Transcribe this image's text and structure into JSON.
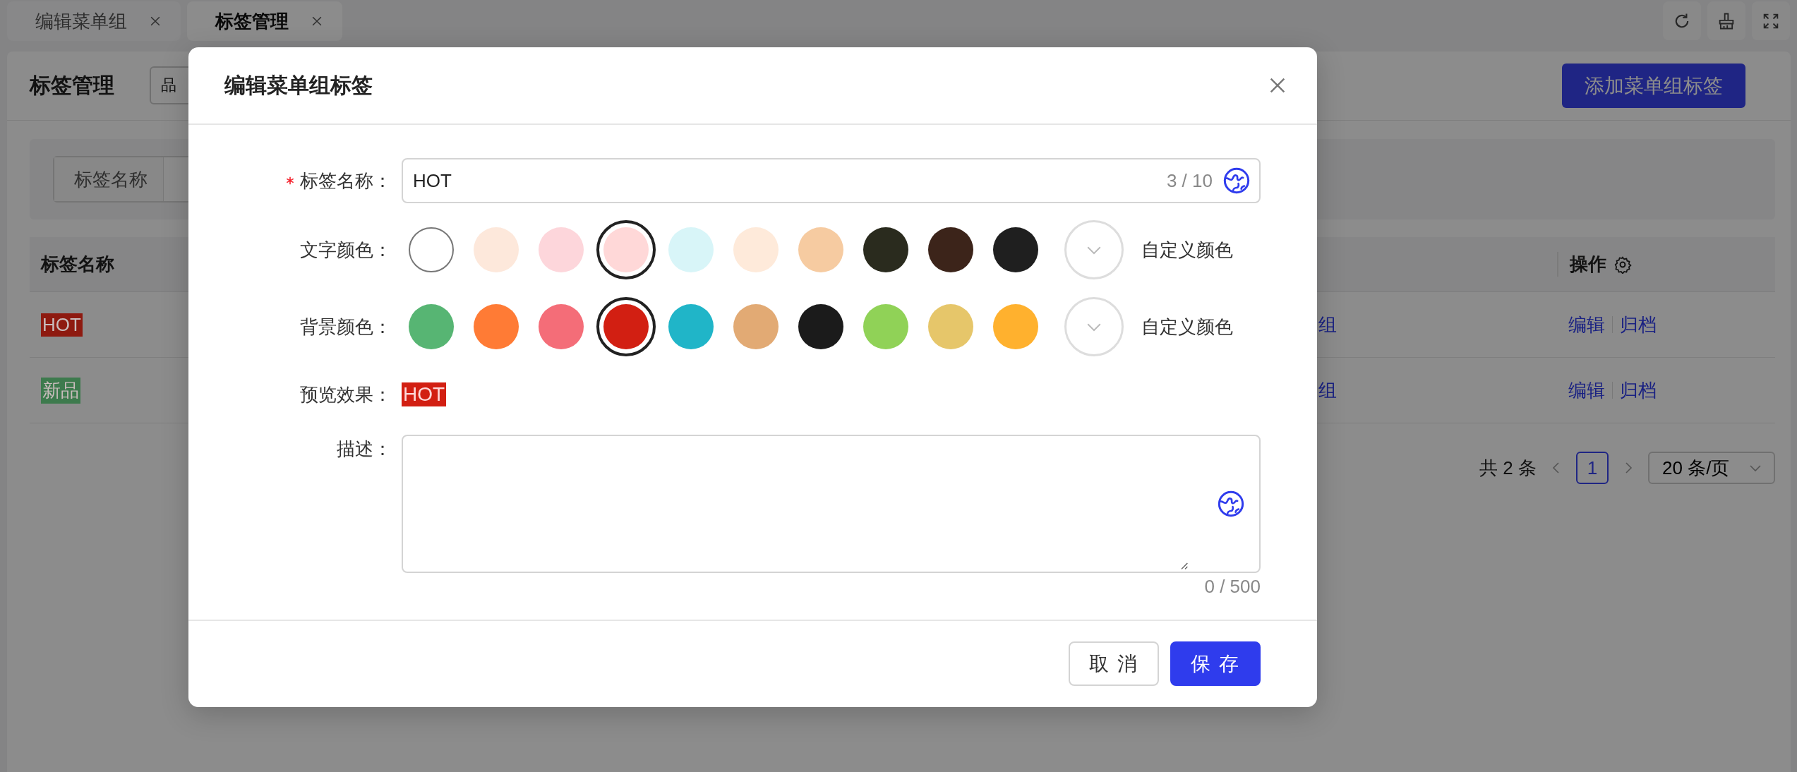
{
  "tabs": [
    {
      "label": "编辑菜单组",
      "selected": false
    },
    {
      "label": "标签管理",
      "selected": true
    }
  ],
  "page": {
    "title": "标签管理",
    "select_value": "品",
    "add_button": "添加菜单组标签"
  },
  "filter": {
    "field_label": "标签名称"
  },
  "table": {
    "columns": [
      {
        "label": "标签名称"
      },
      {
        "label": "操作"
      }
    ],
    "rows": [
      {
        "tag": "HOT",
        "color": "#8e1a10",
        "column_2": "组",
        "actions": [
          "编辑",
          "归档"
        ]
      },
      {
        "tag": "新品",
        "color": "#3d7a4d",
        "column_2": "组",
        "actions": [
          "编辑",
          "归档"
        ]
      }
    ]
  },
  "pagination": {
    "total": "共 2 条",
    "page": "1",
    "page_size": "20 条/页"
  },
  "dialog": {
    "title": "编辑菜单组标签",
    "name_field": {
      "label": "标签名称：",
      "required": true,
      "value": "HOT",
      "count": "3 / 10"
    },
    "text_color": {
      "label": "文字颜色：",
      "custom": "自定义颜色",
      "swatches": [
        {
          "color": "#ffffff",
          "selected": false
        },
        {
          "color": "#fde8db",
          "selected": false
        },
        {
          "color": "#fdd6db",
          "selected": false
        },
        {
          "color": "#ffd8d8",
          "selected": true
        },
        {
          "color": "#d8f5f8",
          "selected": false
        },
        {
          "color": "#feeada",
          "selected": false
        },
        {
          "color": "#f6cba1",
          "selected": false
        },
        {
          "color": "#2a2b1e",
          "selected": false
        },
        {
          "color": "#3c241a",
          "selected": false
        },
        {
          "color": "#1f1f1f",
          "selected": false
        }
      ]
    },
    "background_color": {
      "label": "背景颜色：",
      "custom": "自定义颜色",
      "swatches": [
        {
          "color": "#57b573",
          "selected": false
        },
        {
          "color": "#ff7b35",
          "selected": false
        },
        {
          "color": "#f46d78",
          "selected": false
        },
        {
          "color": "#d21f12",
          "selected": true
        },
        {
          "color": "#20b5c8",
          "selected": false
        },
        {
          "color": "#e2aa74",
          "selected": false
        },
        {
          "color": "#1b1b1b",
          "selected": false
        },
        {
          "color": "#90d257",
          "selected": false
        },
        {
          "color": "#e6c66a",
          "selected": false
        },
        {
          "color": "#ffb12e",
          "selected": false
        }
      ]
    },
    "preview": {
      "label": "预览效果：",
      "text": "HOT"
    },
    "description": {
      "label": "描述：",
      "count": "0 / 500"
    },
    "buttons": [
      {
        "label": "取 消",
        "kind": "default"
      },
      {
        "label": "保 存",
        "kind": "primary"
      }
    ]
  }
}
